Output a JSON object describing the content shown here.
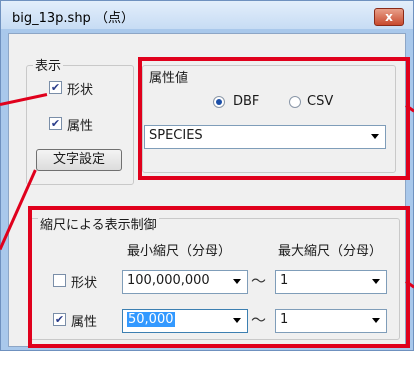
{
  "window": {
    "title": "big_13p.shp （点）",
    "close_label": "x"
  },
  "display_group": {
    "legend": "表示",
    "shape": {
      "label": "形状",
      "checked": true
    },
    "attribute": {
      "label": "属性",
      "checked": true
    },
    "font_button": "文字設定"
  },
  "attribute_group": {
    "legend": "属性値",
    "radio_dbf": {
      "label": "DBF",
      "selected": true
    },
    "radio_csv": {
      "label": "CSV",
      "selected": false
    },
    "field_select": "SPECIES"
  },
  "scale_group": {
    "legend": "縮尺による表示制御",
    "min_header": "最小縮尺（分母）",
    "max_header": "最大縮尺（分母）",
    "tilde": "～",
    "rows": [
      {
        "label": "形状",
        "checked": false,
        "min": "100,000,000",
        "max": "1"
      },
      {
        "label": "属性",
        "checked": true,
        "min": "50,000",
        "max": "1"
      }
    ]
  },
  "icons": {
    "checkmark": "✔",
    "close": "✕"
  },
  "colors": {
    "annotation": "#e0001c",
    "title_gradient_top": "#e3eefb",
    "close_button": "#c84a2e",
    "selection": "#3399ff"
  }
}
